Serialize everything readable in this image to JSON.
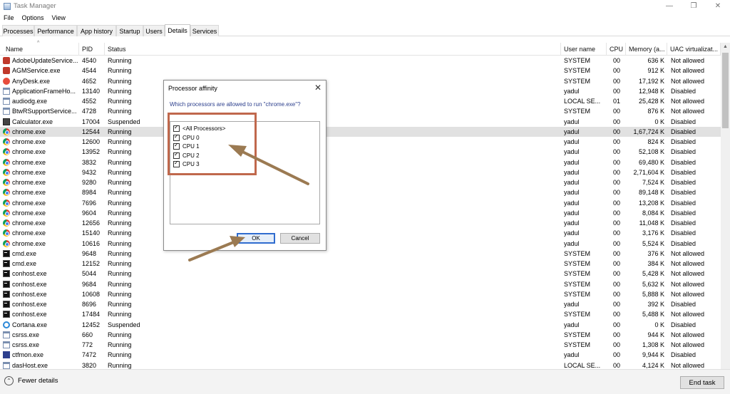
{
  "window": {
    "title": "Task Manager",
    "minimize": "—",
    "maximize": "❐",
    "close": "✕"
  },
  "menu": [
    "File",
    "Options",
    "View"
  ],
  "tabs": [
    "Processes",
    "Performance",
    "App history",
    "Startup",
    "Users",
    "Details",
    "Services"
  ],
  "active_tab": "Details",
  "columns": {
    "name": "Name",
    "pid": "PID",
    "status": "Status",
    "user": "User name",
    "cpu": "CPU",
    "memory": "Memory (a...",
    "uac": "UAC virtualizat..."
  },
  "rows": [
    {
      "name": "AdobeUpdateService...",
      "pid": "4540",
      "status": "Running",
      "user": "SYSTEM",
      "cpu": "00",
      "mem": "636 K",
      "uac": "Not allowed",
      "icon": "adobe-icon"
    },
    {
      "name": "AGMService.exe",
      "pid": "4544",
      "status": "Running",
      "user": "SYSTEM",
      "cpu": "00",
      "mem": "912 K",
      "uac": "Not allowed",
      "icon": "adobe-icon"
    },
    {
      "name": "AnyDesk.exe",
      "pid": "4652",
      "status": "Running",
      "user": "SYSTEM",
      "cpu": "00",
      "mem": "17,192 K",
      "uac": "Not allowed",
      "icon": "anydesk-icon"
    },
    {
      "name": "ApplicationFrameHo...",
      "pid": "13140",
      "status": "Running",
      "user": "yadul",
      "cpu": "00",
      "mem": "12,948 K",
      "uac": "Disabled",
      "icon": "app-icon"
    },
    {
      "name": "audiodg.exe",
      "pid": "4552",
      "status": "Running",
      "user": "LOCAL SE...",
      "cpu": "01",
      "mem": "25,428 K",
      "uac": "Not allowed",
      "icon": "app-icon"
    },
    {
      "name": "BtwRSupportService...",
      "pid": "4728",
      "status": "Running",
      "user": "SYSTEM",
      "cpu": "00",
      "mem": "876 K",
      "uac": "Not allowed",
      "icon": "app-icon"
    },
    {
      "name": "Calculator.exe",
      "pid": "17004",
      "status": "Suspended",
      "user": "yadul",
      "cpu": "00",
      "mem": "0 K",
      "uac": "Disabled",
      "icon": "calculator-icon"
    },
    {
      "name": "chrome.exe",
      "pid": "12544",
      "status": "Running",
      "user": "yadul",
      "cpu": "00",
      "mem": "1,67,724 K",
      "uac": "Disabled",
      "icon": "chrome-icon",
      "selected": true
    },
    {
      "name": "chrome.exe",
      "pid": "12600",
      "status": "Running",
      "user": "yadul",
      "cpu": "00",
      "mem": "824 K",
      "uac": "Disabled",
      "icon": "chrome-icon"
    },
    {
      "name": "chrome.exe",
      "pid": "13952",
      "status": "Running",
      "user": "yadul",
      "cpu": "00",
      "mem": "52,108 K",
      "uac": "Disabled",
      "icon": "chrome-icon"
    },
    {
      "name": "chrome.exe",
      "pid": "3832",
      "status": "Running",
      "user": "yadul",
      "cpu": "00",
      "mem": "69,480 K",
      "uac": "Disabled",
      "icon": "chrome-icon"
    },
    {
      "name": "chrome.exe",
      "pid": "9432",
      "status": "Running",
      "user": "yadul",
      "cpu": "00",
      "mem": "2,71,604 K",
      "uac": "Disabled",
      "icon": "chrome-icon"
    },
    {
      "name": "chrome.exe",
      "pid": "9280",
      "status": "Running",
      "user": "yadul",
      "cpu": "00",
      "mem": "7,524 K",
      "uac": "Disabled",
      "icon": "chrome-icon"
    },
    {
      "name": "chrome.exe",
      "pid": "8984",
      "status": "Running",
      "user": "yadul",
      "cpu": "00",
      "mem": "89,148 K",
      "uac": "Disabled",
      "icon": "chrome-icon"
    },
    {
      "name": "chrome.exe",
      "pid": "7696",
      "status": "Running",
      "user": "yadul",
      "cpu": "00",
      "mem": "13,208 K",
      "uac": "Disabled",
      "icon": "chrome-icon"
    },
    {
      "name": "chrome.exe",
      "pid": "9604",
      "status": "Running",
      "user": "yadul",
      "cpu": "00",
      "mem": "8,084 K",
      "uac": "Disabled",
      "icon": "chrome-icon"
    },
    {
      "name": "chrome.exe",
      "pid": "12656",
      "status": "Running",
      "user": "yadul",
      "cpu": "00",
      "mem": "11,048 K",
      "uac": "Disabled",
      "icon": "chrome-icon"
    },
    {
      "name": "chrome.exe",
      "pid": "15140",
      "status": "Running",
      "user": "yadul",
      "cpu": "00",
      "mem": "3,176 K",
      "uac": "Disabled",
      "icon": "chrome-icon"
    },
    {
      "name": "chrome.exe",
      "pid": "10616",
      "status": "Running",
      "user": "yadul",
      "cpu": "00",
      "mem": "5,524 K",
      "uac": "Disabled",
      "icon": "chrome-icon"
    },
    {
      "name": "cmd.exe",
      "pid": "9648",
      "status": "Running",
      "user": "SYSTEM",
      "cpu": "00",
      "mem": "376 K",
      "uac": "Not allowed",
      "icon": "cmd-icon"
    },
    {
      "name": "cmd.exe",
      "pid": "12152",
      "status": "Running",
      "user": "SYSTEM",
      "cpu": "00",
      "mem": "384 K",
      "uac": "Not allowed",
      "icon": "cmd-icon"
    },
    {
      "name": "conhost.exe",
      "pid": "5044",
      "status": "Running",
      "user": "SYSTEM",
      "cpu": "00",
      "mem": "5,428 K",
      "uac": "Not allowed",
      "icon": "cmd-icon"
    },
    {
      "name": "conhost.exe",
      "pid": "9684",
      "status": "Running",
      "user": "SYSTEM",
      "cpu": "00",
      "mem": "5,632 K",
      "uac": "Not allowed",
      "icon": "cmd-icon"
    },
    {
      "name": "conhost.exe",
      "pid": "10608",
      "status": "Running",
      "user": "SYSTEM",
      "cpu": "00",
      "mem": "5,888 K",
      "uac": "Not allowed",
      "icon": "cmd-icon"
    },
    {
      "name": "conhost.exe",
      "pid": "8696",
      "status": "Running",
      "user": "yadul",
      "cpu": "00",
      "mem": "392 K",
      "uac": "Disabled",
      "icon": "cmd-icon"
    },
    {
      "name": "conhost.exe",
      "pid": "17484",
      "status": "Running",
      "user": "SYSTEM",
      "cpu": "00",
      "mem": "5,488 K",
      "uac": "Not allowed",
      "icon": "cmd-icon"
    },
    {
      "name": "Cortana.exe",
      "pid": "12452",
      "status": "Suspended",
      "user": "yadul",
      "cpu": "00",
      "mem": "0 K",
      "uac": "Disabled",
      "icon": "cortana-icon"
    },
    {
      "name": "csrss.exe",
      "pid": "660",
      "status": "Running",
      "user": "SYSTEM",
      "cpu": "00",
      "mem": "944 K",
      "uac": "Not allowed",
      "icon": "app-icon"
    },
    {
      "name": "csrss.exe",
      "pid": "772",
      "status": "Running",
      "user": "SYSTEM",
      "cpu": "00",
      "mem": "1,308 K",
      "uac": "Not allowed",
      "icon": "app-icon"
    },
    {
      "name": "ctfmon.exe",
      "pid": "7472",
      "status": "Running",
      "user": "yadul",
      "cpu": "00",
      "mem": "9,944 K",
      "uac": "Disabled",
      "icon": "ctfmon-icon"
    },
    {
      "name": "dasHost.exe",
      "pid": "3820",
      "status": "Running",
      "user": "LOCAL SE...",
      "cpu": "00",
      "mem": "4,124 K",
      "uac": "Not allowed",
      "icon": "app-icon"
    }
  ],
  "footer": {
    "fewer_details": "Fewer details",
    "end_task": "End task"
  },
  "dialog": {
    "title": "Processor affinity",
    "question": "Which processors are allowed to run \"chrome.exe\"?",
    "processors": [
      {
        "label": "<All Processors>",
        "checked": true
      },
      {
        "label": "CPU 0",
        "checked": true
      },
      {
        "label": "CPU 1",
        "checked": true
      },
      {
        "label": "CPU 2",
        "checked": true
      },
      {
        "label": "CPU 3",
        "checked": true
      }
    ],
    "ok": "OK",
    "cancel": "Cancel"
  },
  "colors": {
    "annotation": "#c0684c",
    "selection": "#e1e1e1",
    "ok_border": "#2f6ccf"
  }
}
